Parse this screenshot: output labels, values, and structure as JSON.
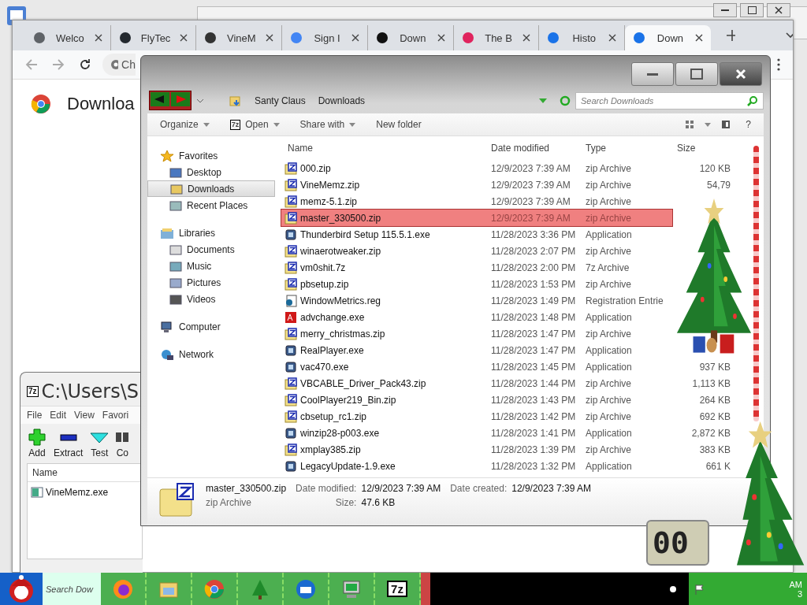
{
  "browser": {
    "tabs": [
      {
        "label": "Welco",
        "selected": false
      },
      {
        "label": "FlyTec",
        "selected": false
      },
      {
        "label": "VineM",
        "selected": false
      },
      {
        "label": "Sign I",
        "selected": false
      },
      {
        "label": "Down",
        "selected": false
      },
      {
        "label": "The B",
        "selected": false
      },
      {
        "label": "Histo",
        "selected": false
      },
      {
        "label": "Down",
        "selected": true
      }
    ],
    "address": "Ch",
    "page_title": "Downloa"
  },
  "explorer": {
    "breadcrumbs": [
      "Santy Claus",
      "Downloads"
    ],
    "search": {
      "placeholder": "Search Downloads"
    },
    "open_logo": "7z",
    "help": "?",
    "toolbar": [
      {
        "label": "Organize",
        "dropdown": true
      },
      {
        "label": "Open",
        "dropdown": true
      },
      {
        "label": "Share with",
        "dropdown": true
      },
      {
        "label": "New folder",
        "dropdown": false
      }
    ],
    "nav": [
      {
        "label": "Favorites",
        "children": [
          {
            "label": "Desktop",
            "selected": false
          },
          {
            "label": "Downloads",
            "selected": true
          },
          {
            "label": "Recent Places",
            "selected": false
          }
        ]
      },
      {
        "label": "Libraries",
        "children": [
          {
            "label": "Documents",
            "selected": false
          },
          {
            "label": "Music",
            "selected": false
          },
          {
            "label": "Pictures",
            "selected": false
          },
          {
            "label": "Videos",
            "selected": false
          }
        ]
      },
      {
        "label": "Computer"
      },
      {
        "label": "Network"
      }
    ],
    "columns": [
      "Name",
      "Date modified",
      "Type",
      "Size"
    ],
    "files": [
      {
        "name": "000.zip",
        "date": "12/9/2023 7:39 AM",
        "type": "zip Archive",
        "size": "120 KB",
        "kind": "zip",
        "selected": false
      },
      {
        "name": "VineMemz.zip",
        "date": "12/9/2023 7:39 AM",
        "type": "zip Archive",
        "size": "54,79",
        "kind": "zip",
        "selected": false
      },
      {
        "name": "memz-5.1.zip",
        "date": "12/9/2023 7:39 AM",
        "type": "zip Archive",
        "kind": "zip",
        "selected": false
      },
      {
        "name": "master_330500.zip",
        "date": "12/9/2023 7:39 AM",
        "type": "zip Archive",
        "kind": "zip",
        "selected": true
      },
      {
        "name": "Thunderbird Setup 115.5.1.exe",
        "date": "11/28/2023 3:36 PM",
        "type": "Application",
        "kind": "app",
        "selected": false
      },
      {
        "name": "winaerotweaker.zip",
        "date": "11/28/2023 2:07 PM",
        "type": "zip Archive",
        "kind": "zip",
        "selected": false
      },
      {
        "name": "vm0shit.7z",
        "date": "11/28/2023 2:00 PM",
        "type": "7z Archive",
        "kind": "zip",
        "selected": false
      },
      {
        "name": "pbsetup.zip",
        "date": "11/28/2023 1:53 PM",
        "type": "zip Archive",
        "kind": "zip",
        "selected": false
      },
      {
        "name": "WindowMetrics.reg",
        "date": "11/28/2023 1:49 PM",
        "type": "Registration Entrie",
        "kind": "reg",
        "selected": false
      },
      {
        "name": "advchange.exe",
        "date": "11/28/2023 1:48 PM",
        "type": "Application",
        "kind": "adv",
        "selected": false
      },
      {
        "name": "merry_christmas.zip",
        "date": "11/28/2023 1:47 PM",
        "type": "zip Archive",
        "kind": "zip",
        "selected": false
      },
      {
        "name": "RealPlayer.exe",
        "date": "11/28/2023 1:47 PM",
        "type": "Application",
        "kind": "app",
        "selected": false
      },
      {
        "name": "vac470.exe",
        "date": "11/28/2023 1:45 PM",
        "type": "Application",
        "size": "937 KB",
        "kind": "app",
        "selected": false
      },
      {
        "name": "VBCABLE_Driver_Pack43.zip",
        "date": "11/28/2023 1:44 PM",
        "type": "zip Archive",
        "size": "1,113 KB",
        "kind": "zip",
        "selected": false
      },
      {
        "name": "CoolPlayer219_Bin.zip",
        "date": "11/28/2023 1:43 PM",
        "type": "zip Archive",
        "size": "264 KB",
        "kind": "zip",
        "selected": false
      },
      {
        "name": "cbsetup_rc1.zip",
        "date": "11/28/2023 1:42 PM",
        "type": "zip Archive",
        "size": "692 KB",
        "kind": "zip",
        "selected": false
      },
      {
        "name": "winzip28-p003.exe",
        "date": "11/28/2023 1:41 PM",
        "type": "Application",
        "size": "2,872 KB",
        "kind": "app",
        "selected": false
      },
      {
        "name": "xmplay385.zip",
        "date": "11/28/2023 1:39 PM",
        "type": "zip Archive",
        "size": "383 KB",
        "kind": "zip",
        "selected": false
      },
      {
        "name": "LegacyUpdate-1.9.exe",
        "date": "11/28/2023 1:32 PM",
        "type": "Application",
        "size": "661 K",
        "kind": "app",
        "selected": false
      }
    ],
    "details": {
      "name": "master_330500.zip",
      "type": "zip Archive",
      "modified_label": "Date modified:",
      "modified": "12/9/2023 7:39 AM",
      "size_label": "Size:",
      "size": "47.6 KB",
      "created_label": "Date created:",
      "created": "12/9/2023 7:39 AM"
    }
  },
  "sevenzip": {
    "logo": "7z",
    "title": "C:\\Users\\S",
    "menu": [
      "File",
      "Edit",
      "View",
      "Favori"
    ],
    "tools": [
      "Add",
      "Extract",
      "Test",
      "Co"
    ],
    "column": "Name",
    "files": [
      "VineMemz.exe"
    ]
  },
  "clock_widget": "00",
  "taskbar": {
    "search": "Search Dow",
    "logo": "7z",
    "tray_time": "AM",
    "tray_date": "3"
  }
}
